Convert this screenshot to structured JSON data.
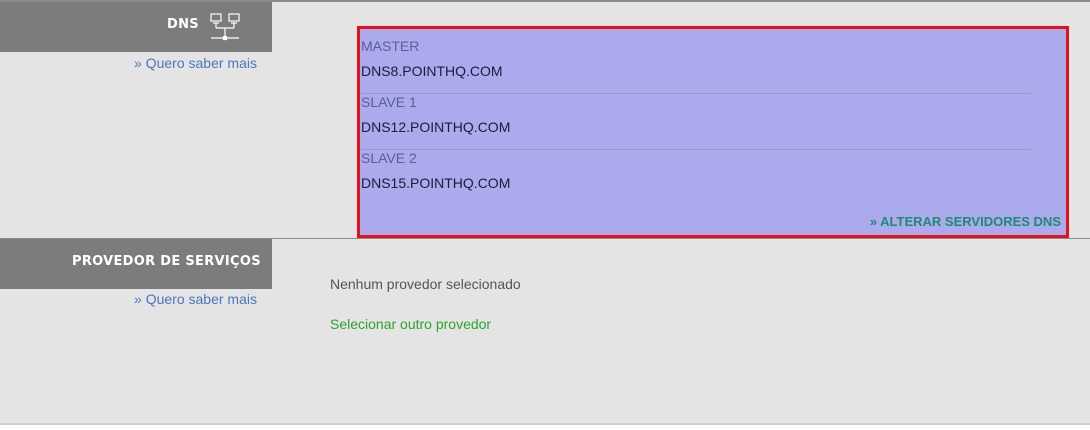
{
  "dns": {
    "title": "DNS",
    "more_link": "» Quero saber mais",
    "servers": [
      {
        "label": "MASTER",
        "value": "DNS8.POINTHQ.COM"
      },
      {
        "label": "SLAVE 1",
        "value": "DNS12.POINTHQ.COM"
      },
      {
        "label": "SLAVE 2",
        "value": "DNS15.POINTHQ.COM"
      }
    ],
    "alter_link": "» ALTERAR SERVIDORES DNS",
    "icon": "network-icon"
  },
  "provider": {
    "title": "PROVEDOR DE SERVIÇOS",
    "more_link": "» Quero saber mais",
    "status": "Nenhum provedor selecionado",
    "select_link": "Selecionar outro provedor"
  },
  "colors": {
    "header_bg": "#7c7c7c",
    "section_bg": "#e4e4e4",
    "panel_bg": "#aaaaec",
    "panel_border": "#e4111b",
    "link_blue": "#4a76c4",
    "link_teal": "#1f8a73",
    "link_green": "#2ea32e"
  }
}
